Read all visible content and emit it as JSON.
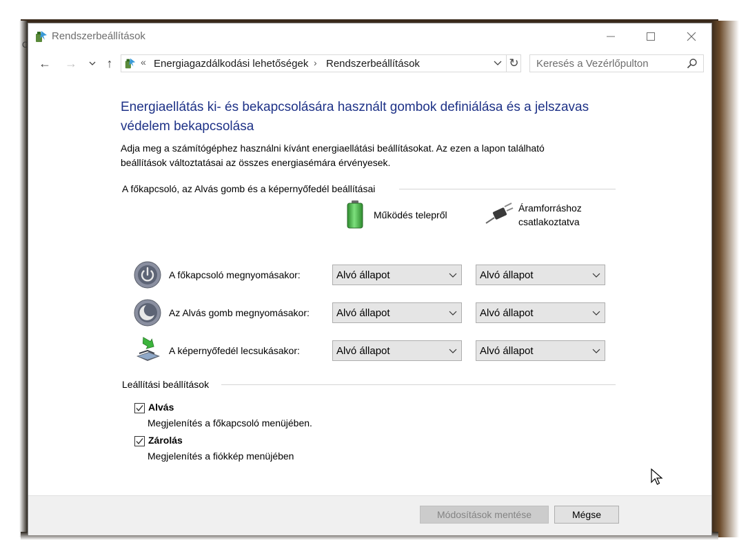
{
  "window": {
    "title": "Rendszerbeállítások",
    "min_glyph": "—",
    "max_glyph": "☐",
    "close_glyph": "✕"
  },
  "nav": {
    "back_glyph": "←",
    "forward_glyph": "→",
    "recent_glyph": "⌄",
    "up_glyph": "↑",
    "refresh_glyph": "↻"
  },
  "address": {
    "overflow": "«",
    "segments": [
      "Energiagazdálkodási lehetőségek",
      "Rendszerbeállítások"
    ],
    "separator": "›",
    "dropdown_glyph": "⌄"
  },
  "search": {
    "placeholder": "Keresés a Vezérlőpulton"
  },
  "page": {
    "title": "Energiaellátás ki- és bekapcsolására használt gombok definiálása és a jelszavas védelem bekapcsolása",
    "description": "Adja meg a számítógéphez használni kívánt energiaellátási beállításokat. Az ezen a lapon található beállítások változtatásai az összes energiasémára érvényesek."
  },
  "power_buttons": {
    "heading": "A főkapcsoló, az Alvás gomb és a képernyőfedél beállításai",
    "columns": {
      "battery": "Működés telepről",
      "plugged_line1": "Áramforráshoz",
      "plugged_line2": "csatlakoztatva"
    },
    "rows": [
      {
        "label": "A főkapcsoló megnyomásakor:",
        "battery": "Alvó állapot",
        "plugged": "Alvó állapot"
      },
      {
        "label": "Az Alvás gomb megnyomásakor:",
        "battery": "Alvó állapot",
        "plugged": "Alvó állapot"
      },
      {
        "label": "A képernyőfedél lecsukásakor:",
        "battery": "Alvó állapot",
        "plugged": "Alvó állapot"
      }
    ]
  },
  "shutdown": {
    "heading": "Leállítási beállítások",
    "items": [
      {
        "label": "Alvás",
        "desc": "Megjelenítés a főkapcsoló menüjében.",
        "checked": true
      },
      {
        "label": "Zárolás",
        "desc": "Megjelenítés a fiókkép menüjében",
        "checked": true
      }
    ]
  },
  "footer": {
    "save_label": "Módosítások mentése",
    "cancel_label": "Mégse"
  },
  "desktop": {
    "edge_text": "C"
  },
  "colors": {
    "title_blue": "#1e3287",
    "battery_green": "#3cb43c"
  }
}
